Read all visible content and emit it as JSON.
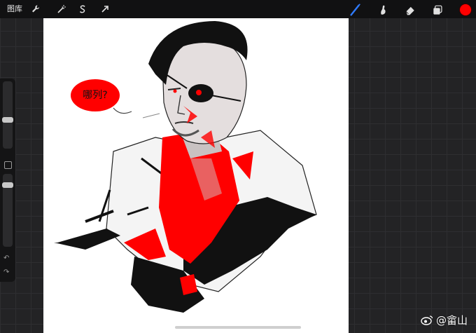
{
  "topbar": {
    "gallery_label": "图库",
    "left_tools": [
      "wrench-icon",
      "magic-wand-icon",
      "selection-s-icon",
      "transform-arrow-icon"
    ],
    "right_tools": [
      "brush-icon",
      "smudge-icon",
      "eraser-icon",
      "layers-icon"
    ],
    "active_tool": "brush-icon"
  },
  "colors": {
    "current_color": "#ff0000",
    "active_tool_tint": "#2f7bff"
  },
  "artwork": {
    "speech_bubble_text": "哪列?"
  },
  "sidebar": {
    "brush_size_level": 0.18,
    "opacity_level": 0.5,
    "undo_glyph": "↶",
    "redo_glyph": "↷"
  },
  "watermark": {
    "text": "@畲山"
  }
}
